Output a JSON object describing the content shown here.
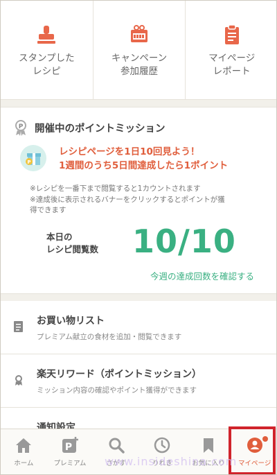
{
  "top_menu": [
    {
      "label": "スタンプした\nレシピ",
      "icon": "stamp-icon"
    },
    {
      "label": "キャンペーン\n参加履歴",
      "icon": "gift-box-icon"
    },
    {
      "label": "マイページ\nレポート",
      "icon": "clipboard-icon"
    }
  ],
  "mission": {
    "heading": "開催中のポイントミッション",
    "title": "レシピページを1日10回見よう！\n1週間のうち5日間達成したら1ポイント",
    "note": "※レシピを一番下まで閲覧すると1カウントされます\n※達成後に表示されるバナーをクリックするとポイントが獲\n得できます",
    "count_label": "本日の\nレシピ閲覧数",
    "count_value": "10/10",
    "link": "今週の達成回数を確認する"
  },
  "list": [
    {
      "title": "お買い物リスト",
      "subtitle": "プレミアム献立の食材を追加・閲覧できます"
    },
    {
      "title": "楽天リワード（ポイントミッション）",
      "subtitle": "ミッション内容の確認やポイント獲得ができます"
    },
    {
      "title": "通知設定",
      "subtitle": ""
    }
  ],
  "nav": [
    {
      "label": "ホーム",
      "icon": "home-icon"
    },
    {
      "label": "プレミアム",
      "icon": "premium-icon"
    },
    {
      "label": "さがす",
      "icon": "search-icon"
    },
    {
      "label": "りれき",
      "icon": "clock-icon"
    },
    {
      "label": "お気に入り",
      "icon": "bookmark-icon"
    },
    {
      "label": "マイページ",
      "icon": "user-icon"
    }
  ],
  "watermark": "www.insideshina.com",
  "colors": {
    "accent": "#e05e3c",
    "green": "#3ab082",
    "highlight": "#d0242c"
  }
}
